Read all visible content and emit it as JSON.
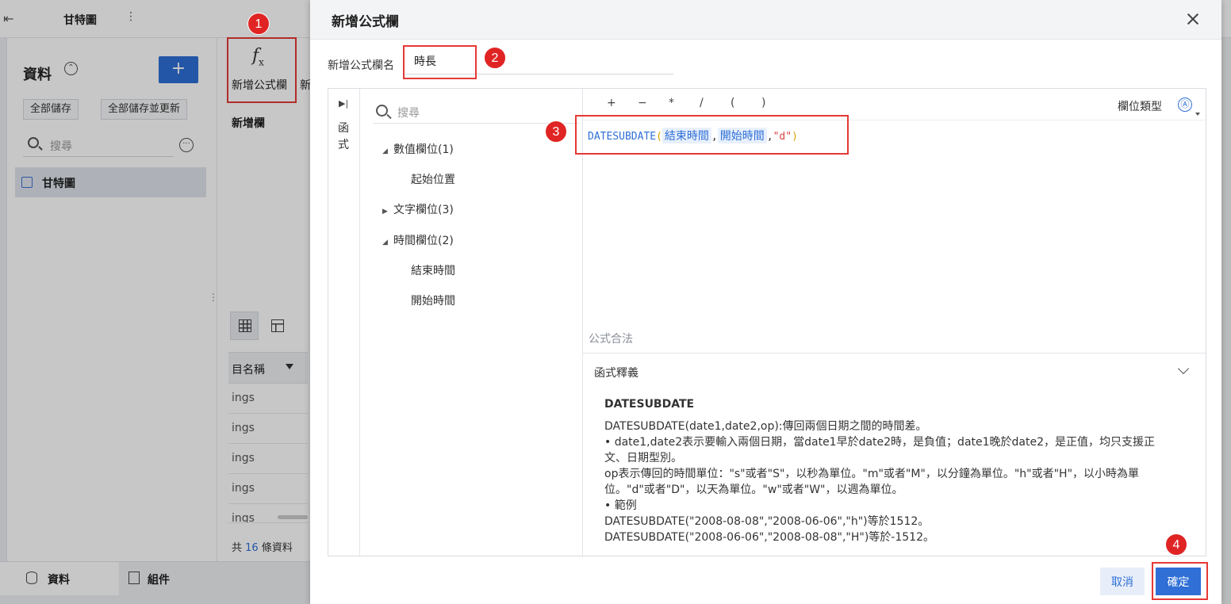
{
  "app": {
    "doc_title": "甘特圖",
    "data_panel_title": "資料",
    "add_label": "+",
    "save_all": "全部儲存",
    "save_all_update": "全部儲存並更新",
    "search_placeholder": "搜尋",
    "tree_item": "甘特圖",
    "add_formula_column": "新增公式欄",
    "add_formula_column_clipped": "新",
    "new_column_tab": "新增欄",
    "column_header": "目名稱",
    "rows": [
      "ings",
      "ings",
      "ings",
      "ings",
      "ings"
    ],
    "count_prefix": "共",
    "count_value": "16",
    "count_suffix": "條資料",
    "bottom_tabs": [
      "資料",
      "組件"
    ]
  },
  "dialog": {
    "title": "新增公式欄",
    "name_label": "新增公式欄名",
    "name_value": "時長",
    "rail_label": "函式",
    "search_placeholder": "搜尋",
    "groups": [
      {
        "label": "數值欄位(1)",
        "expanded": true,
        "children": [
          "起始位置"
        ]
      },
      {
        "label": "文字欄位(3)",
        "expanded": false,
        "children": []
      },
      {
        "label": "時間欄位(2)",
        "expanded": true,
        "children": [
          "結束時間",
          "開始時間"
        ]
      }
    ],
    "operators": [
      "+",
      "−",
      "*",
      "/",
      "(",
      ")"
    ],
    "field_type_label": "欄位類型",
    "field_type_icon": "Ⓐ",
    "formula": {
      "func": "DATESUBDATE",
      "arg1": "結束時間",
      "arg2": "開始時間",
      "arg3": "\"d\""
    },
    "valid_text": "公式合法",
    "doc_header": "函式釋義",
    "doc": {
      "name": "DATESUBDATE",
      "lines": [
        "DATESUBDATE(date1,date2,op):傳回兩個日期之間的時間差。",
        "• date1,date2表示要輸入兩個日期，當date1早於date2時，是負值；date1晚於date2，是正值，均只支援正文、日期型別。",
        "op表示傳回的時間單位：\"s\"或者\"S\"，以秒為單位。\"m\"或者\"M\"，以分鐘為單位。\"h\"或者\"H\"，以小時為單位。\"d\"或者\"D\"，以天為單位。\"w\"或者\"W\"，以週為單位。",
        "• 範例",
        "DATESUBDATE(\"2008-08-08\",\"2008-06-06\",\"h\")等於1512。",
        "DATESUBDATE(\"2008-06-06\",\"2008-08-08\",\"H\")等於-1512。"
      ]
    },
    "cancel_label": "取消",
    "ok_label": "確定"
  },
  "markers": [
    "1",
    "2",
    "3",
    "4"
  ],
  "colors": {
    "accent": "#2f6fd6",
    "marker": "#e02424"
  }
}
